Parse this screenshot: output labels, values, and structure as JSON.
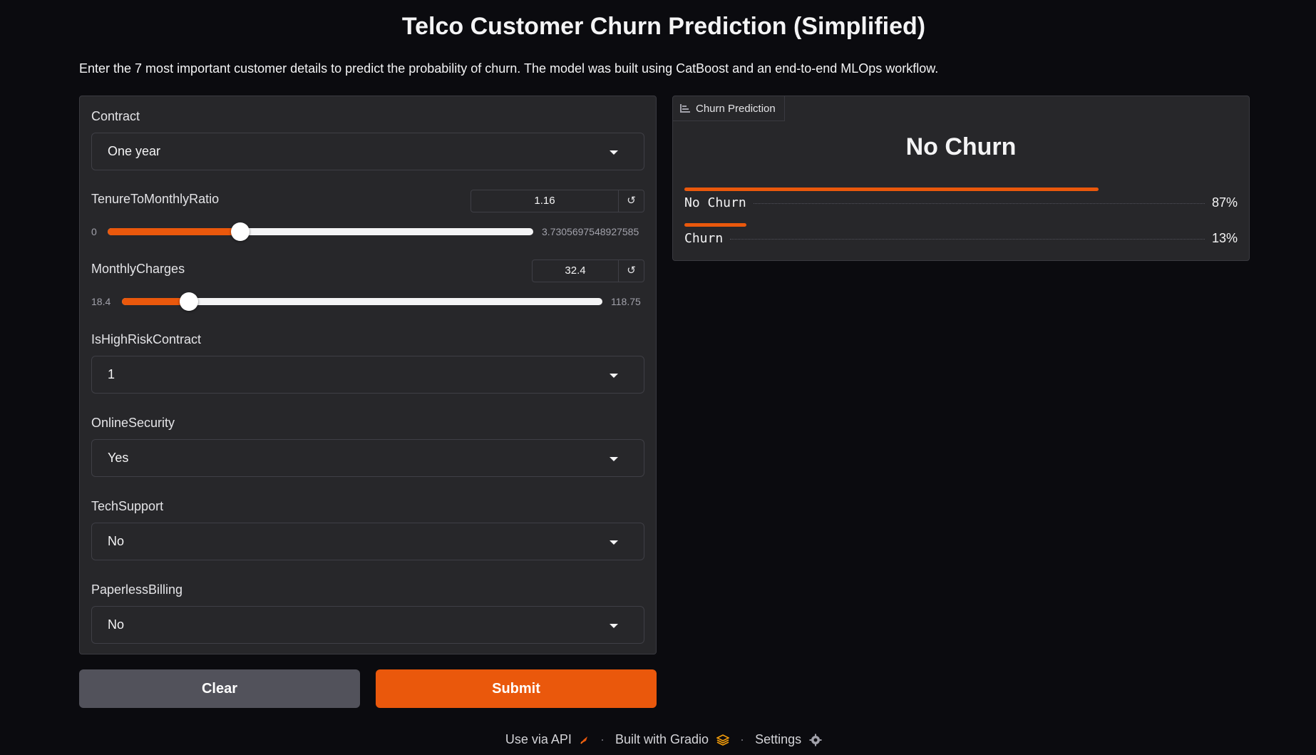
{
  "header": {
    "title": "Telco Customer Churn Prediction (Simplified)",
    "description": "Enter the 7 most important customer details to predict the probability of churn. The model was built using CatBoost and an end-to-end MLOps workflow."
  },
  "inputs": {
    "contract": {
      "label": "Contract",
      "value": "One year"
    },
    "tenure_ratio": {
      "label": "TenureToMonthlyRatio",
      "value": "1.16",
      "min": "0",
      "max": "3.7305697548927585",
      "fraction": 0.311
    },
    "monthly_charges": {
      "label": "MonthlyCharges",
      "value": "32.4",
      "min": "18.4",
      "max": "118.75",
      "fraction": 0.14
    },
    "is_high_risk": {
      "label": "IsHighRiskContract",
      "value": "1"
    },
    "online_security": {
      "label": "OnlineSecurity",
      "value": "Yes"
    },
    "tech_support": {
      "label": "TechSupport",
      "value": "No"
    },
    "paperless_billing": {
      "label": "PaperlessBilling",
      "value": "No"
    }
  },
  "buttons": {
    "clear": "Clear",
    "submit": "Submit",
    "reset_glyph": "↺"
  },
  "output": {
    "tab_label": "Churn Prediction",
    "prediction": "No Churn",
    "confidences": [
      {
        "label": "No Churn",
        "percent": "87%",
        "value": 0.87
      },
      {
        "label": "Churn",
        "percent": "13%",
        "value": 0.13
      }
    ]
  },
  "footer": {
    "api": "Use via API",
    "built_with": "Built with Gradio",
    "settings": "Settings",
    "separator": "·"
  },
  "colors": {
    "accent": "#ea580c",
    "background": "#0b0b0f",
    "panel": "#27272a",
    "secondary_button": "#52525b"
  },
  "icons": [
    "chart-icon",
    "caret-down-icon",
    "reset-icon",
    "rocket-icon",
    "gradio-logo-icon",
    "gear-icon"
  ]
}
